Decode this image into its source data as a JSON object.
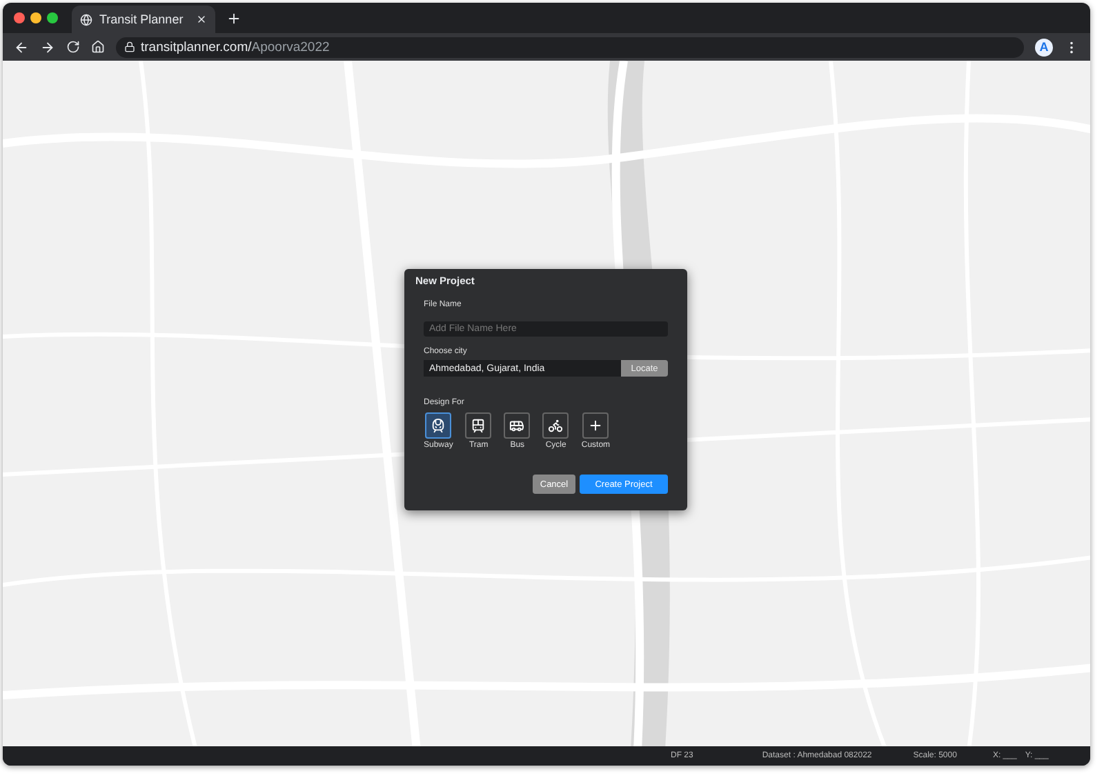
{
  "browser": {
    "tab_title": "Transit Planner",
    "url_host": "transitplanner.com/",
    "url_path": "Apoorva2022",
    "profile_initial": "A"
  },
  "dialog": {
    "title": "New Project",
    "fields": [
      {
        "label": "File Name",
        "placeholder": "Add File Name Here"
      },
      {
        "label": "Choose city",
        "value": "Ahmedabad, Gujarat, India",
        "button": "Locate"
      }
    ],
    "design_label": "Design For",
    "modes": [
      {
        "kind": "subway",
        "label": "Subway",
        "selected": true
      },
      {
        "kind": "tram",
        "label": "Tram",
        "selected": false
      },
      {
        "kind": "bus",
        "label": "Bus",
        "selected": false
      },
      {
        "kind": "cycle",
        "label": "Cycle",
        "selected": false
      },
      {
        "kind": "custom",
        "label": "Custom",
        "selected": false
      }
    ],
    "buttons": [
      {
        "kind": "secondary",
        "label": "Cancel"
      },
      {
        "kind": "primary",
        "label": "Create Project"
      }
    ]
  },
  "status_bar": [
    "DF 23",
    "Dataset : Ahmedabad 082022",
    "Scale: 5000",
    "X: ___",
    "Y: ___"
  ]
}
